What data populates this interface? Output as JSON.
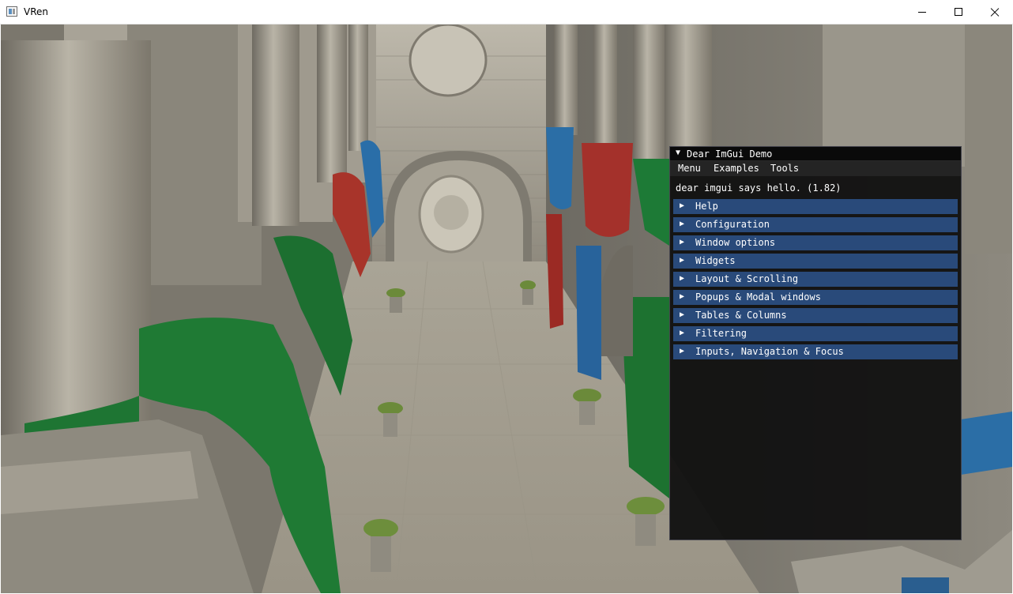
{
  "window": {
    "title": "VRen",
    "icon": "app-window-icon",
    "controls": [
      "minimize-icon",
      "maximize-icon",
      "close-icon"
    ]
  },
  "imgui": {
    "title": "Dear ImGui Demo",
    "collapse_icon": "▼",
    "menu": [
      "Menu",
      "Examples",
      "Tools"
    ],
    "hello_text": "dear imgui says hello. (1.82)",
    "header_icon": "▶",
    "headers": [
      "Help",
      "Configuration",
      "Window options",
      "Widgets",
      "Layout & Scrolling",
      "Popups & Modal windows",
      "Tables & Columns",
      "Filtering",
      "Inputs, Navigation & Focus"
    ],
    "colors": {
      "window_bg": "#0f0f0f",
      "header_bg": "#294a7a",
      "menubar_bg": "#242424"
    }
  }
}
